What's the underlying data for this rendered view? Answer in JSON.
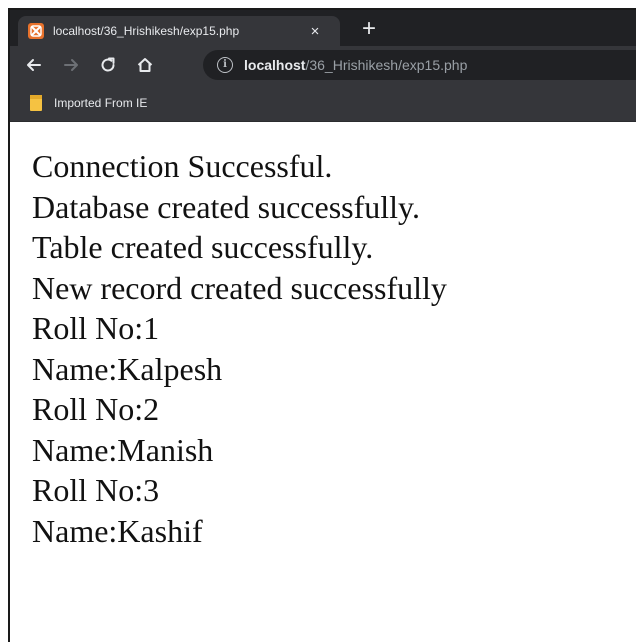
{
  "browser": {
    "tab": {
      "title": "localhost/36_Hrishikesh/exp15.php",
      "close_glyph": "×",
      "favicon": "xampp-icon"
    },
    "new_tab_glyph": "+",
    "nav": {
      "back_icon": "arrow-left-icon",
      "forward_icon": "arrow-right-icon",
      "reload_icon": "reload-icon",
      "home_icon": "home-icon"
    },
    "address": {
      "info_glyph": "i",
      "host": "localhost",
      "path": "/36_Hrishikesh/exp15.php"
    },
    "bookmarks": [
      {
        "label": "Imported From IE",
        "icon": "folder-icon"
      }
    ]
  },
  "page": {
    "lines": [
      "Connection Successful.",
      "Database created successfully.",
      "Table created successfully.",
      "New record created successfully",
      "Roll No:1",
      "Name:Kalpesh",
      "Roll No:2",
      "Name:Manish",
      "Roll No:3",
      "Name:Kashif"
    ]
  },
  "colors": {
    "tabstrip": "#202124",
    "toolbar": "#35363a",
    "omnibox": "#202124",
    "favicon": "#e8722c",
    "folder": "#f5c242"
  }
}
